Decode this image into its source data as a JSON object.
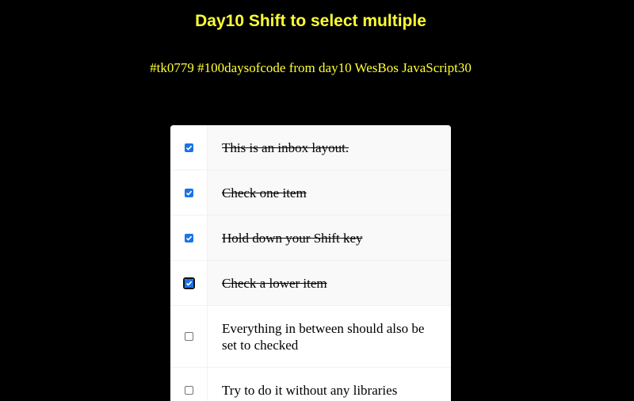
{
  "header": {
    "title": "Day10 Shift to select multiple",
    "subtitle": "#tk0779 #100daysofcode from day10 WesBos JavaScript30"
  },
  "inbox": {
    "items": [
      {
        "label": "This is an inbox layout.",
        "checked": true
      },
      {
        "label": "Check one item",
        "checked": true
      },
      {
        "label": "Hold down your Shift key",
        "checked": true
      },
      {
        "label": "Check a lower item",
        "checked": true,
        "focused": true
      },
      {
        "label": "Everything in between should also be set to checked",
        "checked": false
      },
      {
        "label": "Try to do it without any libraries",
        "checked": false
      }
    ]
  },
  "colors": {
    "background": "#000000",
    "heading": "#ffff33",
    "checkbox_accent": "#1a73e8"
  },
  "icons": {
    "checkmark": "checkmark-icon"
  }
}
